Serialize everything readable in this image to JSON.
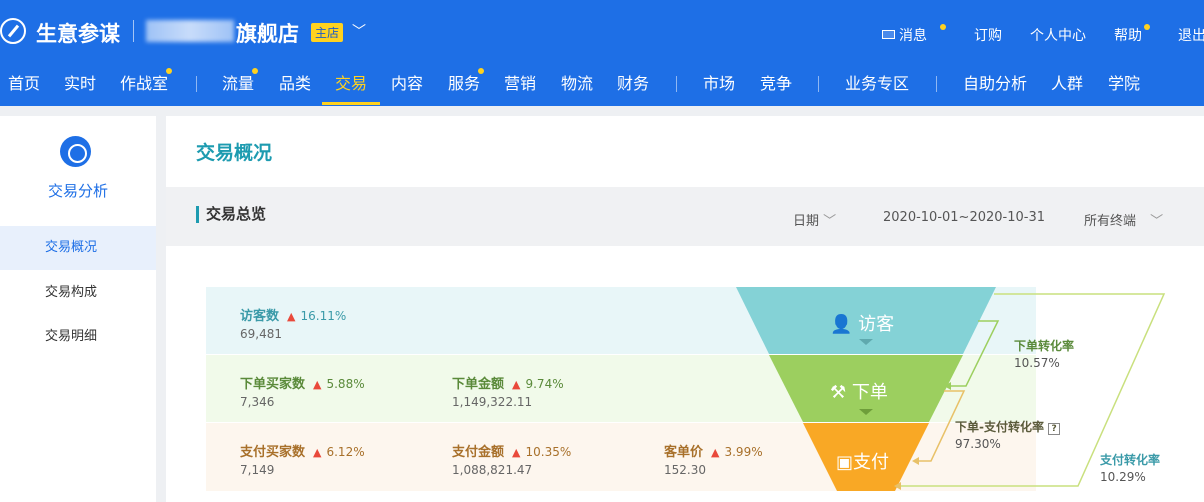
{
  "header": {
    "app_title": "生意参谋",
    "shop_name": "旗舰店",
    "shop_badge": "主店",
    "top_links": [
      "消息",
      "订购",
      "个人中心",
      "帮助",
      "退出"
    ],
    "nav": [
      "首页",
      "实时",
      "作战室",
      "流量",
      "品类",
      "交易",
      "内容",
      "服务",
      "营销",
      "物流",
      "财务",
      "市场",
      "竞争",
      "业务专区",
      "自助分析",
      "人群",
      "学院"
    ],
    "active_nav": "交易"
  },
  "sidebar": {
    "title": "交易分析",
    "items": [
      "交易概况",
      "交易构成",
      "交易明细"
    ],
    "active_item": "交易概况"
  },
  "main": {
    "page_title": "交易概况",
    "section_title": "交易总览",
    "filters": {
      "date_label": "日期",
      "date_range": "2020-10-01~2020-10-31",
      "terminal": "所有终端"
    }
  },
  "funnel": {
    "rows": [
      {
        "metrics": [
          {
            "label": "访客数",
            "change": "16.11%",
            "value": "69,481"
          }
        ]
      },
      {
        "metrics": [
          {
            "label": "下单买家数",
            "change": "5.88%",
            "value": "7,346"
          },
          {
            "label": "下单金额",
            "change": "9.74%",
            "value": "1,149,322.11"
          }
        ]
      },
      {
        "metrics": [
          {
            "label": "支付买家数",
            "change": "6.12%",
            "value": "7,149"
          },
          {
            "label": "支付金额",
            "change": "10.35%",
            "value": "1,088,821.47"
          },
          {
            "label": "客单价",
            "change": "3.99%",
            "value": "152.30"
          }
        ]
      }
    ],
    "stages": [
      "访客",
      "下单",
      "支付"
    ],
    "conversions": [
      {
        "label": "下单转化率",
        "value": "10.57%"
      },
      {
        "label": "下单-支付转化率",
        "value": "97.30%"
      },
      {
        "label": "支付转化率",
        "value": "10.29%"
      }
    ],
    "colors": {
      "visit": "#84d2d6",
      "order": "#9ccf5f",
      "pay": "#f9a825"
    }
  }
}
